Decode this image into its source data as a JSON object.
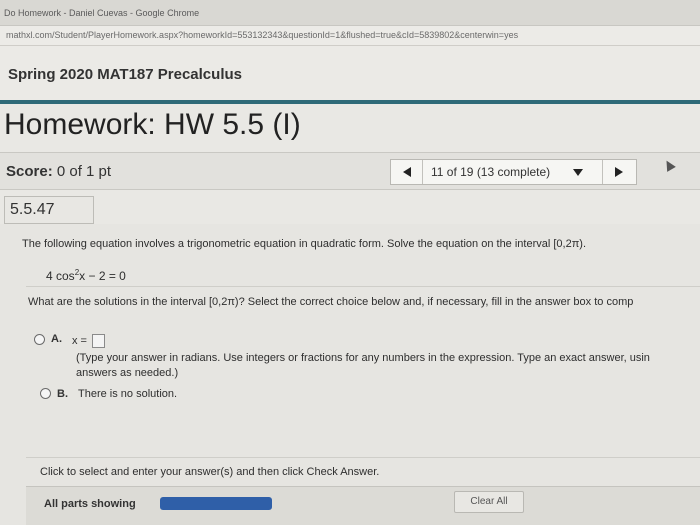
{
  "browser": {
    "window_title": "Do Homework - Daniel Cuevas - Google Chrome",
    "url": "mathxl.com/Student/PlayerHomework.aspx?homeworkId=553132343&questionId=1&flushed=true&cId=5839802&centerwin=yes"
  },
  "course": {
    "title": "Spring 2020 MAT187 Precalculus"
  },
  "homework": {
    "title": "Homework: HW 5.5 (I)"
  },
  "score": {
    "label": "Score:",
    "value": "0 of 1 pt"
  },
  "nav": {
    "position": "11 of 19 (13 complete)"
  },
  "question": {
    "number": "5.5.47",
    "prompt": "The following equation involves a trigonometric equation in quadratic form. Solve the equation on the interval [0,2π).",
    "equation": {
      "lhs_coef": "4 cos",
      "exponent": "2",
      "rhs": "x − 2 = 0"
    },
    "instruction": "What are the solutions in the interval [0,2π)? Select the correct choice below and, if necessary, fill in the answer box to comp",
    "options": [
      {
        "label": "A.",
        "prefix": "x =",
        "hint_line1": "(Type your answer in radians. Use integers or fractions for any numbers in the expression. Type an exact answer, usin",
        "hint_line2": "answers as needed.)"
      },
      {
        "label": "B.",
        "text": "There is no solution."
      }
    ],
    "footer": "Click to select and enter your answer(s) and then click Check Answer."
  },
  "bottom": {
    "all_parts": "All parts showing",
    "clear_all": "Clear All"
  },
  "colors": {
    "accent_rule": "#2f6a78",
    "progress": "#2f5fa8"
  }
}
